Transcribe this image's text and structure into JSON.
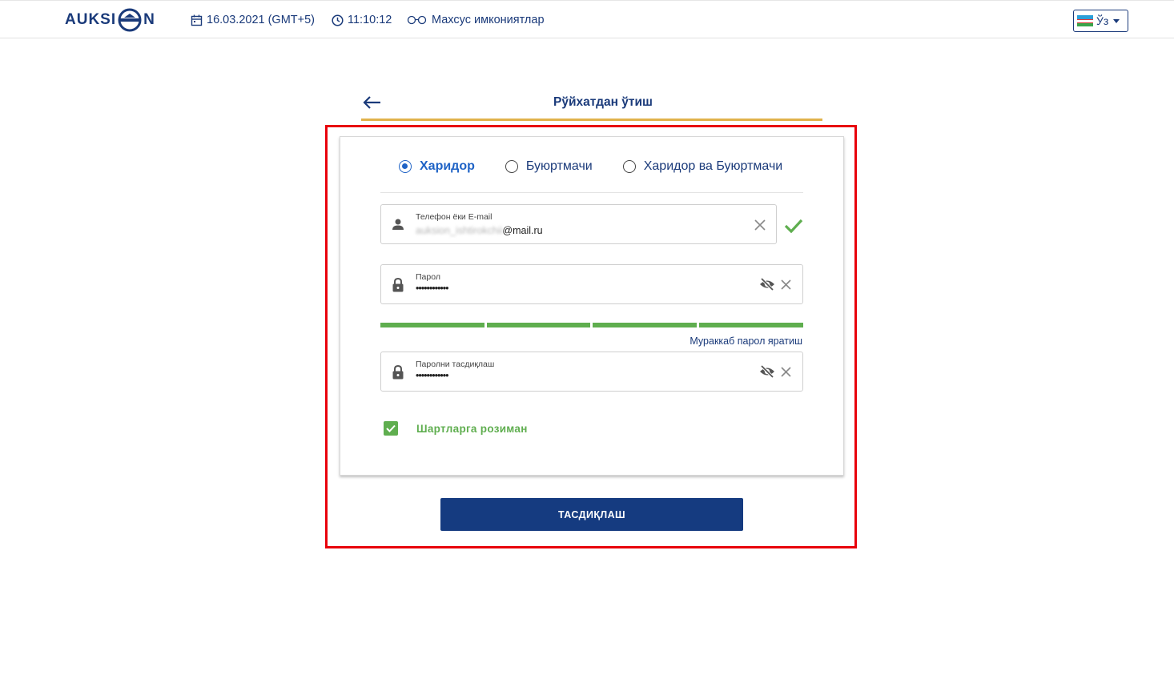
{
  "header": {
    "logo_text_left": "AUKSI",
    "logo_text_right": "N",
    "date": "16.03.2021 (GMT+5)",
    "time": "11:10:12",
    "special_features": "Махсус имкониятлар",
    "language": "Ўз"
  },
  "page": {
    "title": "Рўйхатдан ўтиш"
  },
  "form": {
    "roles": [
      {
        "label": "Харидор",
        "selected": true
      },
      {
        "label": "Буюртмачи",
        "selected": false
      },
      {
        "label": "Харидор ва Буюртмачи",
        "selected": false
      }
    ],
    "login": {
      "label": "Телефон ёки E-mail",
      "value_hidden": "auksion_ishtirokchii",
      "value_visible": "@mail.ru"
    },
    "password": {
      "label": "Парол",
      "value": "••••••••••••"
    },
    "strength_segments_filled": 4,
    "generate_link": "Мураккаб парол яратиш",
    "confirm_password": {
      "label": "Паролни тасдиқлаш",
      "value": "••••••••••••"
    },
    "terms_label": "Шартларга розиман",
    "terms_checked": true,
    "submit_label": "ТАСДИҚЛАШ"
  },
  "colors": {
    "brand_navy": "#153b80",
    "accent_gold": "#e1b24a",
    "success_green": "#5fae4f",
    "radio_blue": "#1f63c6",
    "highlight_red": "#e8000b"
  }
}
